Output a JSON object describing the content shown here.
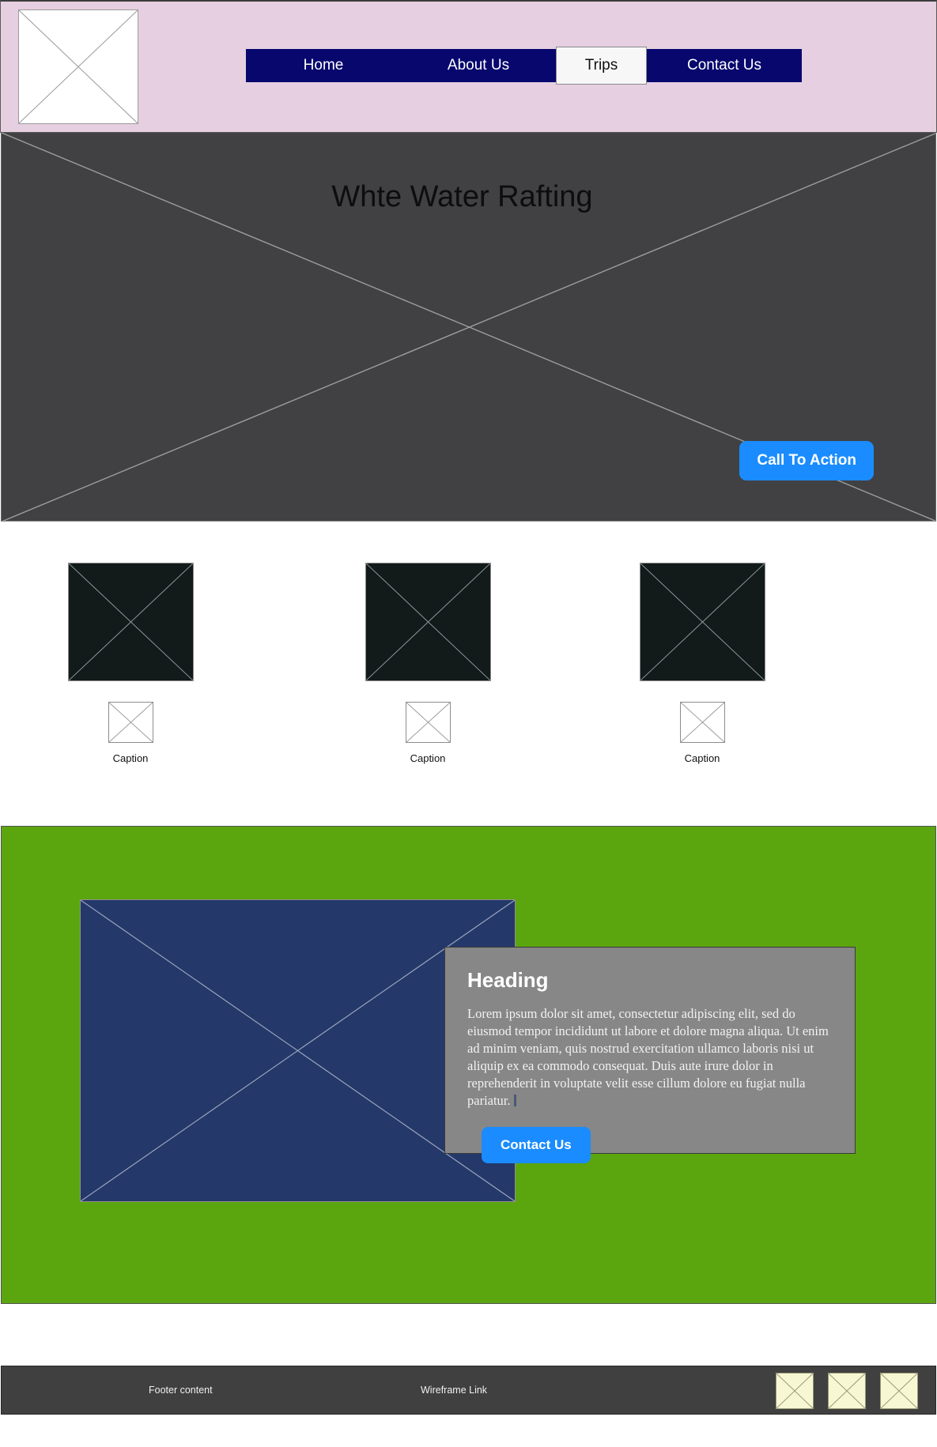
{
  "header": {
    "logo_alt": "logo-placeholder",
    "background_color": "#e6cfe0",
    "nav": {
      "items": [
        {
          "label": "Home",
          "active": false
        },
        {
          "label": "About Us",
          "active": false
        },
        {
          "label": "Trips",
          "active": true
        },
        {
          "label": "Contact Us",
          "active": false
        }
      ],
      "background_color": "#07076e",
      "active_background_color": "#f7f7f7"
    }
  },
  "hero": {
    "title": "Whte Water Rafting",
    "background_color": "#414042",
    "cta_label": "Call To Action",
    "cta_color": "#1a8cff"
  },
  "cards": [
    {
      "caption": "Caption",
      "image_alt": "image-placeholder",
      "icon_alt": "icon-placeholder"
    },
    {
      "caption": "Caption",
      "image_alt": "image-placeholder",
      "icon_alt": "icon-placeholder"
    },
    {
      "caption": "Caption",
      "image_alt": "image-placeholder",
      "icon_alt": "icon-placeholder"
    }
  ],
  "feature": {
    "background_color": "#5ba50f",
    "image_alt": "feature-image-placeholder",
    "image_color": "#24386a",
    "card_background_color": "#878787",
    "heading": "Heading",
    "body": "Lorem ipsum dolor sit amet, consectetur adipiscing elit, sed do eiusmod tempor incididunt ut labore et dolore magna aliqua. Ut enim ad minim veniam, quis nostrud exercitation ullamco laboris nisi ut aliquip ex ea commodo consequat. Duis aute irure dolor in reprehenderit in voluptate velit esse cillum dolore eu fugiat nulla pariatur.",
    "button_label": "Contact Us",
    "button_color": "#1a8cff"
  },
  "footer": {
    "background_color": "#404040",
    "left_text": "Footer content",
    "link_text": "Wireframe Link",
    "icons": [
      {
        "alt": "footer-icon-placeholder"
      },
      {
        "alt": "footer-icon-placeholder"
      },
      {
        "alt": "footer-icon-placeholder"
      }
    ]
  }
}
